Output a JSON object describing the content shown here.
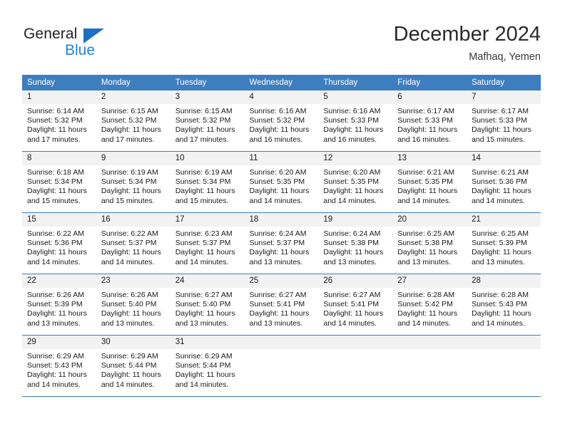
{
  "brand": {
    "name_primary": "General",
    "name_secondary": "Blue",
    "triangle_icon": "triangle-icon",
    "accent_color": "#1f83d8",
    "header_color": "#3c7ebf"
  },
  "header": {
    "title": "December 2024",
    "subtitle": "Mafhaq, Yemen"
  },
  "calendar": {
    "weekday_headers": [
      "Sunday",
      "Monday",
      "Tuesday",
      "Wednesday",
      "Thursday",
      "Friday",
      "Saturday"
    ],
    "weeks": [
      [
        {
          "day": "1",
          "sunrise": "Sunrise: 6:14 AM",
          "sunset": "Sunset: 5:32 PM",
          "daylight1": "Daylight: 11 hours",
          "daylight2": "and 17 minutes."
        },
        {
          "day": "2",
          "sunrise": "Sunrise: 6:15 AM",
          "sunset": "Sunset: 5:32 PM",
          "daylight1": "Daylight: 11 hours",
          "daylight2": "and 17 minutes."
        },
        {
          "day": "3",
          "sunrise": "Sunrise: 6:15 AM",
          "sunset": "Sunset: 5:32 PM",
          "daylight1": "Daylight: 11 hours",
          "daylight2": "and 17 minutes."
        },
        {
          "day": "4",
          "sunrise": "Sunrise: 6:16 AM",
          "sunset": "Sunset: 5:32 PM",
          "daylight1": "Daylight: 11 hours",
          "daylight2": "and 16 minutes."
        },
        {
          "day": "5",
          "sunrise": "Sunrise: 6:16 AM",
          "sunset": "Sunset: 5:33 PM",
          "daylight1": "Daylight: 11 hours",
          "daylight2": "and 16 minutes."
        },
        {
          "day": "6",
          "sunrise": "Sunrise: 6:17 AM",
          "sunset": "Sunset: 5:33 PM",
          "daylight1": "Daylight: 11 hours",
          "daylight2": "and 16 minutes."
        },
        {
          "day": "7",
          "sunrise": "Sunrise: 6:17 AM",
          "sunset": "Sunset: 5:33 PM",
          "daylight1": "Daylight: 11 hours",
          "daylight2": "and 15 minutes."
        }
      ],
      [
        {
          "day": "8",
          "sunrise": "Sunrise: 6:18 AM",
          "sunset": "Sunset: 5:34 PM",
          "daylight1": "Daylight: 11 hours",
          "daylight2": "and 15 minutes."
        },
        {
          "day": "9",
          "sunrise": "Sunrise: 6:19 AM",
          "sunset": "Sunset: 5:34 PM",
          "daylight1": "Daylight: 11 hours",
          "daylight2": "and 15 minutes."
        },
        {
          "day": "10",
          "sunrise": "Sunrise: 6:19 AM",
          "sunset": "Sunset: 5:34 PM",
          "daylight1": "Daylight: 11 hours",
          "daylight2": "and 15 minutes."
        },
        {
          "day": "11",
          "sunrise": "Sunrise: 6:20 AM",
          "sunset": "Sunset: 5:35 PM",
          "daylight1": "Daylight: 11 hours",
          "daylight2": "and 14 minutes."
        },
        {
          "day": "12",
          "sunrise": "Sunrise: 6:20 AM",
          "sunset": "Sunset: 5:35 PM",
          "daylight1": "Daylight: 11 hours",
          "daylight2": "and 14 minutes."
        },
        {
          "day": "13",
          "sunrise": "Sunrise: 6:21 AM",
          "sunset": "Sunset: 5:35 PM",
          "daylight1": "Daylight: 11 hours",
          "daylight2": "and 14 minutes."
        },
        {
          "day": "14",
          "sunrise": "Sunrise: 6:21 AM",
          "sunset": "Sunset: 5:36 PM",
          "daylight1": "Daylight: 11 hours",
          "daylight2": "and 14 minutes."
        }
      ],
      [
        {
          "day": "15",
          "sunrise": "Sunrise: 6:22 AM",
          "sunset": "Sunset: 5:36 PM",
          "daylight1": "Daylight: 11 hours",
          "daylight2": "and 14 minutes."
        },
        {
          "day": "16",
          "sunrise": "Sunrise: 6:22 AM",
          "sunset": "Sunset: 5:37 PM",
          "daylight1": "Daylight: 11 hours",
          "daylight2": "and 14 minutes."
        },
        {
          "day": "17",
          "sunrise": "Sunrise: 6:23 AM",
          "sunset": "Sunset: 5:37 PM",
          "daylight1": "Daylight: 11 hours",
          "daylight2": "and 14 minutes."
        },
        {
          "day": "18",
          "sunrise": "Sunrise: 6:24 AM",
          "sunset": "Sunset: 5:37 PM",
          "daylight1": "Daylight: 11 hours",
          "daylight2": "and 13 minutes."
        },
        {
          "day": "19",
          "sunrise": "Sunrise: 6:24 AM",
          "sunset": "Sunset: 5:38 PM",
          "daylight1": "Daylight: 11 hours",
          "daylight2": "and 13 minutes."
        },
        {
          "day": "20",
          "sunrise": "Sunrise: 6:25 AM",
          "sunset": "Sunset: 5:38 PM",
          "daylight1": "Daylight: 11 hours",
          "daylight2": "and 13 minutes."
        },
        {
          "day": "21",
          "sunrise": "Sunrise: 6:25 AM",
          "sunset": "Sunset: 5:39 PM",
          "daylight1": "Daylight: 11 hours",
          "daylight2": "and 13 minutes."
        }
      ],
      [
        {
          "day": "22",
          "sunrise": "Sunrise: 6:26 AM",
          "sunset": "Sunset: 5:39 PM",
          "daylight1": "Daylight: 11 hours",
          "daylight2": "and 13 minutes."
        },
        {
          "day": "23",
          "sunrise": "Sunrise: 6:26 AM",
          "sunset": "Sunset: 5:40 PM",
          "daylight1": "Daylight: 11 hours",
          "daylight2": "and 13 minutes."
        },
        {
          "day": "24",
          "sunrise": "Sunrise: 6:27 AM",
          "sunset": "Sunset: 5:40 PM",
          "daylight1": "Daylight: 11 hours",
          "daylight2": "and 13 minutes."
        },
        {
          "day": "25",
          "sunrise": "Sunrise: 6:27 AM",
          "sunset": "Sunset: 5:41 PM",
          "daylight1": "Daylight: 11 hours",
          "daylight2": "and 13 minutes."
        },
        {
          "day": "26",
          "sunrise": "Sunrise: 6:27 AM",
          "sunset": "Sunset: 5:41 PM",
          "daylight1": "Daylight: 11 hours",
          "daylight2": "and 14 minutes."
        },
        {
          "day": "27",
          "sunrise": "Sunrise: 6:28 AM",
          "sunset": "Sunset: 5:42 PM",
          "daylight1": "Daylight: 11 hours",
          "daylight2": "and 14 minutes."
        },
        {
          "day": "28",
          "sunrise": "Sunrise: 6:28 AM",
          "sunset": "Sunset: 5:43 PM",
          "daylight1": "Daylight: 11 hours",
          "daylight2": "and 14 minutes."
        }
      ],
      [
        {
          "day": "29",
          "sunrise": "Sunrise: 6:29 AM",
          "sunset": "Sunset: 5:43 PM",
          "daylight1": "Daylight: 11 hours",
          "daylight2": "and 14 minutes."
        },
        {
          "day": "30",
          "sunrise": "Sunrise: 6:29 AM",
          "sunset": "Sunset: 5:44 PM",
          "daylight1": "Daylight: 11 hours",
          "daylight2": "and 14 minutes."
        },
        {
          "day": "31",
          "sunrise": "Sunrise: 6:29 AM",
          "sunset": "Sunset: 5:44 PM",
          "daylight1": "Daylight: 11 hours",
          "daylight2": "and 14 minutes."
        },
        {
          "day": "",
          "sunrise": "",
          "sunset": "",
          "daylight1": "",
          "daylight2": ""
        },
        {
          "day": "",
          "sunrise": "",
          "sunset": "",
          "daylight1": "",
          "daylight2": ""
        },
        {
          "day": "",
          "sunrise": "",
          "sunset": "",
          "daylight1": "",
          "daylight2": ""
        },
        {
          "day": "",
          "sunrise": "",
          "sunset": "",
          "daylight1": "",
          "daylight2": ""
        }
      ]
    ]
  }
}
